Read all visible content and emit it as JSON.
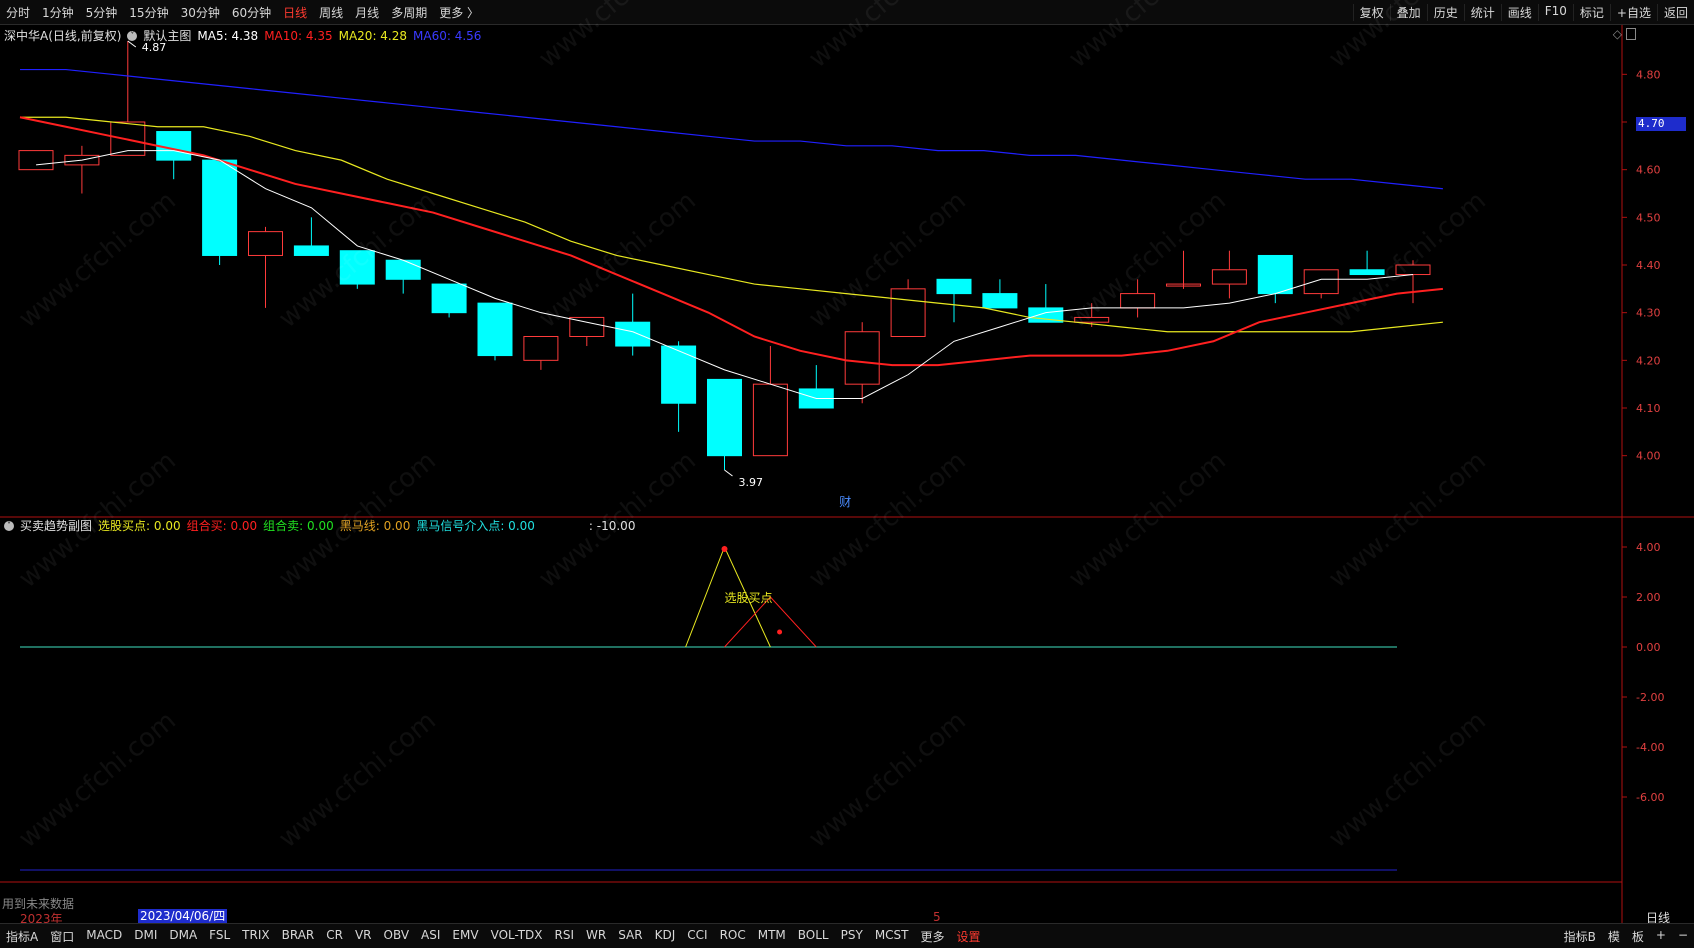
{
  "topbar": {
    "periods": [
      "分时",
      "1分钟",
      "5分钟",
      "15分钟",
      "30分钟",
      "60分钟",
      "日线",
      "周线",
      "月线",
      "多周期",
      "更多 〉"
    ],
    "active": "日线",
    "tools": [
      "复权",
      "叠加",
      "历史",
      "统计",
      "画线",
      "F10",
      "标记",
      "+自选",
      "返回"
    ]
  },
  "main_header": {
    "stock": "深中华A(日线,前复权)",
    "icon": "chevron-down-icon",
    "chart_name": "默认主图",
    "ma5": "MA5: 4.38",
    "ma10": "MA10: 4.35",
    "ma20": "MA20: 4.28",
    "ma60": "MA60: 4.56"
  },
  "sub_header": {
    "title": "买卖趋势副图",
    "buy_point": "选股买点: 0.00",
    "combo_buy": "组合买: 0.00",
    "combo_sell": "组合卖: 0.00",
    "dark_horse": "黑马线: 0.00",
    "dark_signal": "黑马信号介入点: 0.00",
    "extra": ": -10.00"
  },
  "annotations": {
    "high": "4.87",
    "low": "3.97",
    "finance_mark": "财",
    "buy_label": "选股买点",
    "future_data": "用到未来数据",
    "year": "2023年",
    "date": "2023/04/06/四",
    "month_mark": "5",
    "right_period": "日线"
  },
  "price_axis": {
    "labels": [
      "4.80",
      "4.70",
      "4.60",
      "4.50",
      "4.40",
      "4.30",
      "4.20",
      "4.10",
      "4.00"
    ],
    "current": "4.70"
  },
  "sub_axis": {
    "labels": [
      "4.00",
      "2.00",
      "0.00",
      "-2.00",
      "-4.00",
      "-6.00"
    ]
  },
  "bottombar": {
    "left": "指标A",
    "window": "窗口",
    "indicators": [
      "MACD",
      "DMI",
      "DMA",
      "FSL",
      "TRIX",
      "BRAR",
      "CR",
      "VR",
      "OBV",
      "ASI",
      "EMV",
      "VOL-TDX",
      "RSI",
      "WR",
      "SAR",
      "KDJ",
      "CCI",
      "ROC",
      "MTM",
      "BOLL",
      "PSY",
      "MCST",
      "更多"
    ],
    "settings": "设置",
    "right": [
      "指标B",
      "模",
      "板",
      "+",
      "−"
    ]
  },
  "watermark": "www.cfchi.com",
  "colors": {
    "up": "#ff3b3b",
    "down": "#00ffff",
    "ma5": "#ffffff",
    "ma10": "#ff2020",
    "ma20": "#e8e820",
    "ma60": "#2020ff",
    "axis": "#b01010"
  },
  "chart_data": {
    "type": "candlestick",
    "title": "深中华A(日线,前复权)",
    "ylim": [
      3.95,
      4.85
    ],
    "candles": [
      {
        "o": 4.6,
        "h": 4.64,
        "l": 4.6,
        "c": 4.64
      },
      {
        "o": 4.61,
        "h": 4.65,
        "l": 4.55,
        "c": 4.63
      },
      {
        "o": 4.63,
        "h": 4.87,
        "l": 4.63,
        "c": 4.7
      },
      {
        "o": 4.68,
        "h": 4.68,
        "l": 4.58,
        "c": 4.62
      },
      {
        "o": 4.62,
        "h": 4.62,
        "l": 4.4,
        "c": 4.42
      },
      {
        "o": 4.42,
        "h": 4.48,
        "l": 4.31,
        "c": 4.47
      },
      {
        "o": 4.44,
        "h": 4.5,
        "l": 4.42,
        "c": 4.42
      },
      {
        "o": 4.43,
        "h": 4.43,
        "l": 4.35,
        "c": 4.36
      },
      {
        "o": 4.41,
        "h": 4.41,
        "l": 4.34,
        "c": 4.37
      },
      {
        "o": 4.36,
        "h": 4.36,
        "l": 4.29,
        "c": 4.3
      },
      {
        "o": 4.32,
        "h": 4.32,
        "l": 4.2,
        "c": 4.21
      },
      {
        "o": 4.2,
        "h": 4.25,
        "l": 4.18,
        "c": 4.25
      },
      {
        "o": 4.25,
        "h": 4.29,
        "l": 4.23,
        "c": 4.29
      },
      {
        "o": 4.28,
        "h": 4.34,
        "l": 4.21,
        "c": 4.23
      },
      {
        "o": 4.23,
        "h": 4.24,
        "l": 4.05,
        "c": 4.11
      },
      {
        "o": 4.16,
        "h": 4.16,
        "l": 3.97,
        "c": 4.0
      },
      {
        "o": 4.0,
        "h": 4.23,
        "l": 4.0,
        "c": 4.15
      },
      {
        "o": 4.14,
        "h": 4.19,
        "l": 4.1,
        "c": 4.1
      },
      {
        "o": 4.15,
        "h": 4.28,
        "l": 4.11,
        "c": 4.26
      },
      {
        "o": 4.25,
        "h": 4.37,
        "l": 4.25,
        "c": 4.35
      },
      {
        "o": 4.37,
        "h": 4.37,
        "l": 4.28,
        "c": 4.34
      },
      {
        "o": 4.34,
        "h": 4.37,
        "l": 4.31,
        "c": 4.31
      },
      {
        "o": 4.31,
        "h": 4.36,
        "l": 4.28,
        "c": 4.28
      },
      {
        "o": 4.28,
        "h": 4.32,
        "l": 4.27,
        "c": 4.29
      },
      {
        "o": 4.31,
        "h": 4.37,
        "l": 4.29,
        "c": 4.34
      },
      {
        "o": 4.36,
        "h": 4.43,
        "l": 4.35,
        "c": 4.36
      },
      {
        "o": 4.36,
        "h": 4.43,
        "l": 4.33,
        "c": 4.39
      },
      {
        "o": 4.42,
        "h": 4.42,
        "l": 4.32,
        "c": 4.34
      },
      {
        "o": 4.34,
        "h": 4.39,
        "l": 4.33,
        "c": 4.39
      },
      {
        "o": 4.39,
        "h": 4.43,
        "l": 4.38,
        "c": 4.38
      },
      {
        "o": 4.38,
        "h": 4.41,
        "l": 4.32,
        "c": 4.4
      }
    ],
    "ma5": [
      4.61,
      4.62,
      4.64,
      4.64,
      4.62,
      4.56,
      4.52,
      4.44,
      4.41,
      4.37,
      4.33,
      4.3,
      4.28,
      4.26,
      4.22,
      4.18,
      4.15,
      4.12,
      4.12,
      4.17,
      4.24,
      4.27,
      4.3,
      4.31,
      4.31,
      4.31,
      4.32,
      4.34,
      4.37,
      4.37,
      4.38
    ],
    "ma10": [
      4.71,
      4.69,
      4.67,
      4.65,
      4.63,
      4.6,
      4.57,
      4.55,
      4.53,
      4.51,
      4.48,
      4.45,
      4.42,
      4.38,
      4.34,
      4.3,
      4.25,
      4.22,
      4.2,
      4.19,
      4.19,
      4.2,
      4.21,
      4.21,
      4.21,
      4.22,
      4.24,
      4.28,
      4.3,
      4.32,
      4.34,
      4.35
    ],
    "ma20": [
      4.71,
      4.71,
      4.7,
      4.69,
      4.69,
      4.67,
      4.64,
      4.62,
      4.58,
      4.55,
      4.52,
      4.49,
      4.45,
      4.42,
      4.4,
      4.38,
      4.36,
      4.35,
      4.34,
      4.33,
      4.32,
      4.31,
      4.29,
      4.28,
      4.27,
      4.26,
      4.26,
      4.26,
      4.26,
      4.26,
      4.27,
      4.28
    ],
    "ma60": [
      4.81,
      4.81,
      4.8,
      4.79,
      4.78,
      4.77,
      4.76,
      4.75,
      4.74,
      4.73,
      4.72,
      4.71,
      4.7,
      4.69,
      4.68,
      4.67,
      4.66,
      4.66,
      4.65,
      4.65,
      4.64,
      4.64,
      4.63,
      4.63,
      4.62,
      4.61,
      4.6,
      4.59,
      4.58,
      4.58,
      4.57,
      4.56
    ],
    "sub_series": {
      "yellow_triangle": [
        {
          "i": 14,
          "v": 0
        },
        {
          "i": 15,
          "v": 4
        },
        {
          "i": 16,
          "v": 0
        }
      ],
      "red_triangle": [
        {
          "i": 15,
          "v": 0
        },
        {
          "i": 16,
          "v": 2
        },
        {
          "i": 17,
          "v": 0
        }
      ],
      "zero_line": 0,
      "ylim": [
        -7,
        5
      ]
    }
  }
}
